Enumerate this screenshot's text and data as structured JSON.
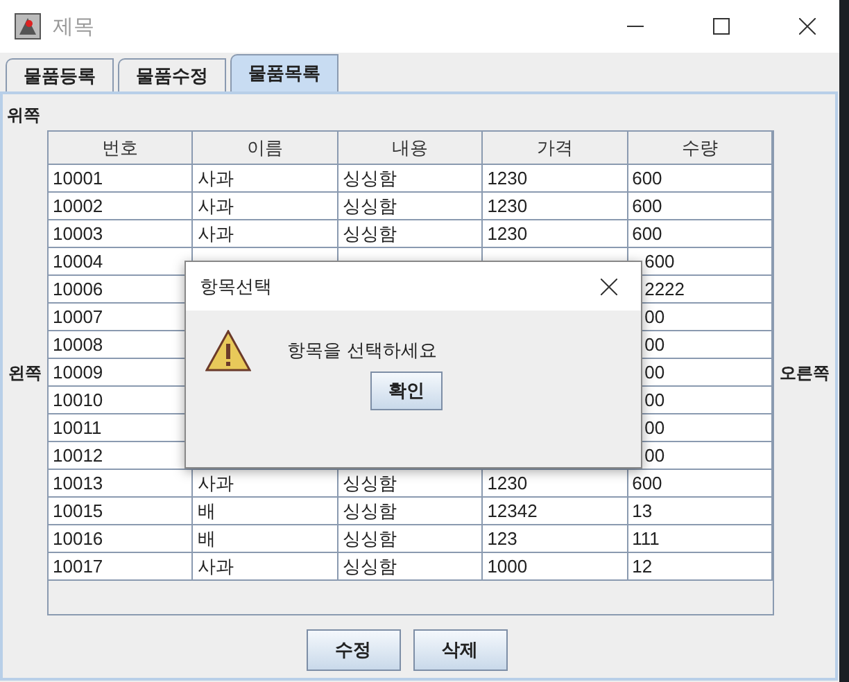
{
  "window": {
    "title": "제목"
  },
  "tabs": [
    {
      "label": "물품등록",
      "selected": false
    },
    {
      "label": "물품수정",
      "selected": false
    },
    {
      "label": "물품목록",
      "selected": true
    }
  ],
  "panel": {
    "top_label": "위쪽",
    "left_label": "왼쪽",
    "right_label": "오른쪽"
  },
  "table": {
    "columns": [
      "번호",
      "이름",
      "내용",
      "가격",
      "수량"
    ],
    "rows": [
      {
        "cells": [
          "10001",
          "사과",
          "싱싱함",
          "1230",
          "600"
        ]
      },
      {
        "cells": [
          "10002",
          "사과",
          "싱싱함",
          "1230",
          "600"
        ]
      },
      {
        "cells": [
          "10003",
          "사과",
          "싱싱함",
          "1230",
          "600"
        ]
      },
      {
        "cells": [
          "10004",
          null,
          null,
          null,
          "600"
        ]
      },
      {
        "cells": [
          "10006",
          null,
          null,
          null,
          "2222"
        ]
      },
      {
        "cells": [
          "10007",
          null,
          null,
          null,
          "00"
        ]
      },
      {
        "cells": [
          "10008",
          null,
          null,
          null,
          "00"
        ]
      },
      {
        "cells": [
          "10009",
          null,
          null,
          null,
          "00"
        ]
      },
      {
        "cells": [
          "10010",
          null,
          null,
          null,
          "00"
        ]
      },
      {
        "cells": [
          "10011",
          null,
          null,
          null,
          "00"
        ]
      },
      {
        "cells": [
          "10012",
          null,
          null,
          null,
          "00"
        ]
      },
      {
        "cells": [
          "10013",
          "사과",
          "싱싱함",
          "1230",
          "600"
        ]
      },
      {
        "cells": [
          "10015",
          "배",
          "싱싱함",
          "12342",
          "13"
        ]
      },
      {
        "cells": [
          "10016",
          "배",
          "싱싱함",
          "123",
          "111"
        ]
      },
      {
        "cells": [
          "10017",
          "사과",
          "싱싱함",
          "1000",
          "12"
        ]
      }
    ]
  },
  "buttons": [
    "수정",
    "삭제"
  ],
  "dialog": {
    "title": "항목선택",
    "message": "항목을 선택하세요",
    "ok": "확인"
  }
}
